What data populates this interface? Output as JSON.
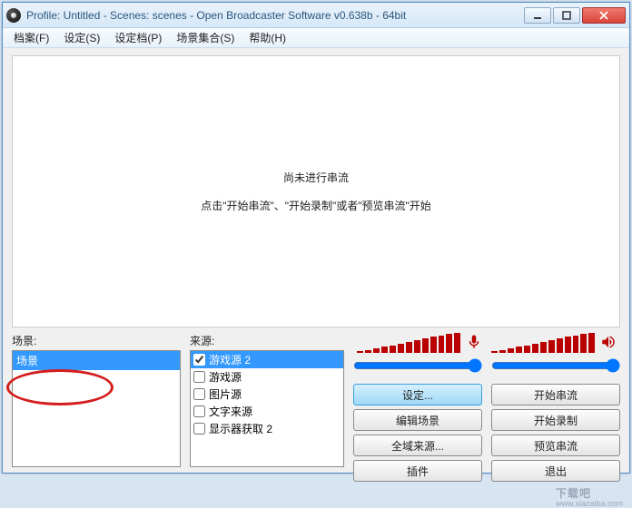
{
  "window": {
    "title": "Profile: Untitled - Scenes: scenes - Open Broadcaster Software v0.638b - 64bit"
  },
  "menu": {
    "items": [
      "档案(F)",
      "设定(S)",
      "设定档(P)",
      "场景集合(S)",
      "帮助(H)"
    ]
  },
  "preview": {
    "line1": "尚未进行串流",
    "line2": "点击\"开始串流\"、\"开始录制\"或者\"预览串流\"开始"
  },
  "panels": {
    "scenes_label": "场景:",
    "sources_label": "来源:"
  },
  "scenes": [
    {
      "label": "场景",
      "selected": true
    }
  ],
  "sources": [
    {
      "label": "游戏源 2",
      "checked": true,
      "selected": true
    },
    {
      "label": "游戏源",
      "checked": false,
      "selected": false
    },
    {
      "label": "图片源",
      "checked": false,
      "selected": false
    },
    {
      "label": "文字来源",
      "checked": false,
      "selected": false
    },
    {
      "label": "显示器获取 2",
      "checked": false,
      "selected": false
    }
  ],
  "buttons": {
    "settings": "设定...",
    "start_stream": "开始串流",
    "edit_scene": "编辑场景",
    "start_record": "开始录制",
    "global_sources": "全域来源...",
    "preview_stream": "预览串流",
    "plugins": "插件",
    "exit": "退出"
  },
  "watermark": {
    "main": "下载吧",
    "sub": "www.xiazaiba.com"
  }
}
